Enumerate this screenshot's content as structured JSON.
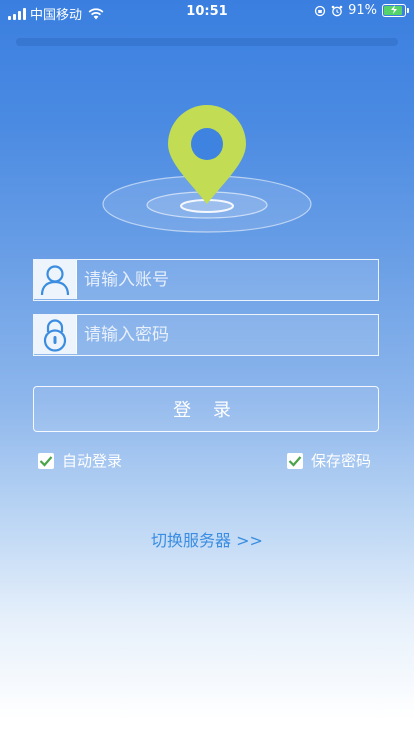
{
  "status_bar": {
    "carrier": "中国移动",
    "time": "10:51",
    "battery_percent": "91%",
    "battery_level": 0.91
  },
  "login": {
    "account_placeholder": "请输入账号",
    "password_placeholder": "请输入密码",
    "submit_label": "登 录",
    "auto_login_label": "自动登录",
    "auto_login_checked": true,
    "save_password_label": "保存密码",
    "save_password_checked": true,
    "switch_server_label": "切换服务器 >>"
  },
  "icons": {
    "logo": "location-pin-icon",
    "account": "user-icon",
    "password": "lock-icon"
  },
  "colors": {
    "pin_green": "#c2dc54",
    "icon_blue": "#3a8de0",
    "check_green": "#4aa44a"
  }
}
